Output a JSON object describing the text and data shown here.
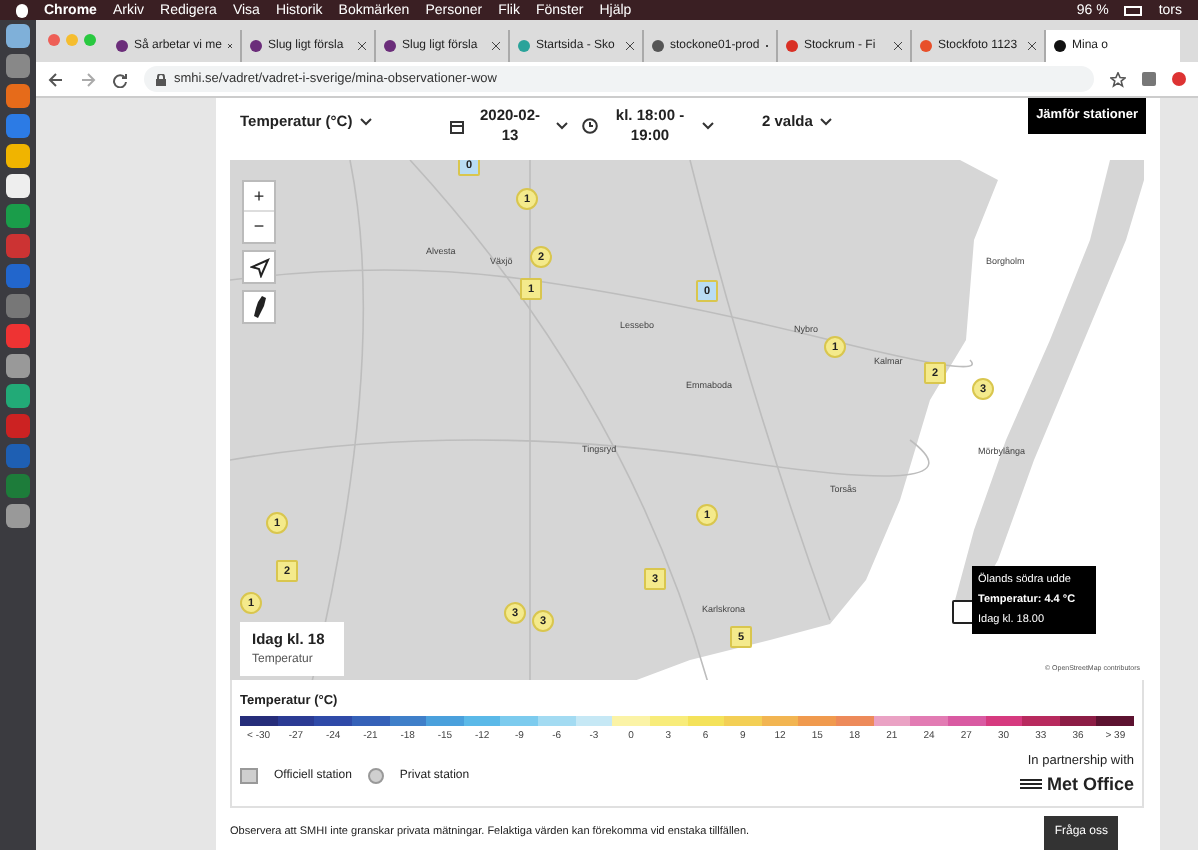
{
  "menu_bar": {
    "app": "Chrome",
    "items": [
      "Arkiv",
      "Redigera",
      "Visa",
      "Historik",
      "Bokmärken",
      "Personer",
      "Flik",
      "Fönster",
      "Hjälp"
    ],
    "battery": "96 %",
    "day": "tors"
  },
  "tabs": [
    {
      "label": "Så arbetar vi me",
      "selected": false,
      "color": "#6b2d7a"
    },
    {
      "label": "Slug ligt försla",
      "selected": false,
      "color": "#6b2d7a"
    },
    {
      "label": "Slug ligt försla",
      "selected": false,
      "color": "#6b2d7a"
    },
    {
      "label": "Startsida - Sko",
      "selected": false,
      "color": "#2aa39a"
    },
    {
      "label": "stockone01-prod",
      "selected": false,
      "color": "#555555"
    },
    {
      "label": "Stockrum - Fi",
      "selected": false,
      "color": "#d93025"
    },
    {
      "label": "Stockfoto 1123",
      "selected": false,
      "color": "#e8502a"
    },
    {
      "label": "Mina o",
      "selected": true,
      "color": "#111111"
    }
  ],
  "address": "smhi.se/vadret/vadret-i-sverige/mina-observationer-wow",
  "filters": {
    "parameter": "Temperatur (°C)",
    "date": "2020-02-13",
    "time": "kl. 18:00 - 19:00",
    "station_type": "2 valda",
    "compare_button": "Jämför stationer"
  },
  "map": {
    "zoom_in": "+",
    "zoom_out": "−",
    "cities": [
      "Alvesta",
      "Växjö",
      "Lessebo",
      "Nybro",
      "Emmaboda",
      "Kalmar",
      "Borgholm",
      "Mörbylånga",
      "Tingsryd",
      "Torsås",
      "Karlskrona"
    ],
    "markers": [
      {
        "kind": "official",
        "count": "0",
        "color": "#b9dcf3",
        "selected": false
      },
      {
        "kind": "private",
        "count": "1",
        "color": "#f4ea8c",
        "selected": false
      },
      {
        "kind": "private",
        "count": "2",
        "color": "#f4ea8c",
        "selected": false
      },
      {
        "kind": "official",
        "count": "1",
        "color": "#f4ea8c",
        "selected": false
      },
      {
        "kind": "official",
        "count": "0",
        "color": "#b9dcf3",
        "selected": false
      },
      {
        "kind": "private",
        "count": "1",
        "color": "#f4ea8c",
        "selected": false
      },
      {
        "kind": "official",
        "count": "2",
        "color": "#f4ea8c",
        "selected": false
      },
      {
        "kind": "private",
        "count": "3",
        "color": "#f4ea8c",
        "selected": false
      },
      {
        "kind": "private",
        "count": "1",
        "color": "#f4ea8c",
        "selected": false
      },
      {
        "kind": "private",
        "count": "1",
        "color": "#f4ea8c",
        "selected": false
      },
      {
        "kind": "official",
        "count": "2",
        "color": "#f4ea8c",
        "selected": false
      },
      {
        "kind": "official",
        "count": "3",
        "color": "#f4ea8c",
        "selected": false
      },
      {
        "kind": "private",
        "count": "1",
        "color": "#f4ea8c",
        "selected": false
      },
      {
        "kind": "private",
        "count": "3",
        "color": "#f4ea8c",
        "selected": false
      },
      {
        "kind": "private",
        "count": "3",
        "color": "#f4ea8c",
        "selected": false
      },
      {
        "kind": "official",
        "count": "5",
        "color": "#f4ea8c",
        "selected": false
      },
      {
        "kind": "official",
        "color": "#ffffff",
        "selected": true
      }
    ],
    "tooltip": {
      "station": "Ölands södra udde",
      "reading": "Temperatur: 4.4 °C",
      "time": "Idag kl. 18.00"
    },
    "time_box": {
      "title": "Idag kl. 18",
      "subtitle": "Temperatur"
    },
    "attribution": "© OpenStreetMap contributors"
  },
  "legend": {
    "title": "Temperatur (°C)",
    "scale": [
      {
        "label": "< -30",
        "color": "#262d7a"
      },
      {
        "label": "-27",
        "color": "#2b3b94"
      },
      {
        "label": "-24",
        "color": "#2f4aa8"
      },
      {
        "label": "-21",
        "color": "#3561b8"
      },
      {
        "label": "-18",
        "color": "#3f7fc9"
      },
      {
        "label": "-15",
        "color": "#4aa0dc"
      },
      {
        "label": "-12",
        "color": "#5bb9e8"
      },
      {
        "label": "-9",
        "color": "#7ccbee"
      },
      {
        "label": "-6",
        "color": "#a3dbf2"
      },
      {
        "label": "-3",
        "color": "#c6e8f5"
      },
      {
        "label": "0",
        "color": "#fbf3a6"
      },
      {
        "label": "3",
        "color": "#f8ec7a"
      },
      {
        "label": "6",
        "color": "#f4e25a"
      },
      {
        "label": "9",
        "color": "#f3cf55"
      },
      {
        "label": "12",
        "color": "#f2b552"
      },
      {
        "label": "15",
        "color": "#f09a4e"
      },
      {
        "label": "18",
        "color": "#ed8a5a"
      },
      {
        "label": "21",
        "color": "#eaa2c4"
      },
      {
        "label": "24",
        "color": "#e27bb3"
      },
      {
        "label": "27",
        "color": "#d95aa2"
      },
      {
        "label": "30",
        "color": "#d63a7f"
      },
      {
        "label": "33",
        "color": "#b82a5e"
      },
      {
        "label": "36",
        "color": "#8c1d45"
      },
      {
        "label": "> 39",
        "color": "#5c1230"
      }
    ],
    "official": "Officiell station",
    "private": "Privat station",
    "partnership": "In partnership with",
    "partner": "Met Office"
  },
  "note": "Observera att SMHI inte granskar privata mätningar. Felaktiga värden kan förekomma vid enstaka tillfällen.",
  "help_button": "Fråga oss"
}
